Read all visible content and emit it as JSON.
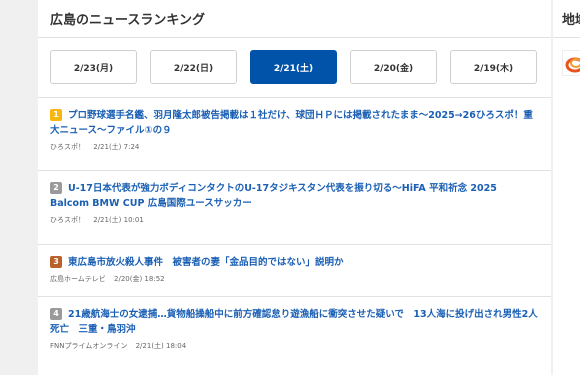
{
  "main": {
    "title": "広島のニュースランキング",
    "date_tabs": [
      {
        "label": "2/23(月)",
        "active": false
      },
      {
        "label": "2/22(日)",
        "active": false
      },
      {
        "label": "2/21(土)",
        "active": true
      },
      {
        "label": "2/20(金)",
        "active": false
      },
      {
        "label": "2/19(木)",
        "active": false
      }
    ],
    "news": [
      {
        "rank": "1",
        "badge_color": "#f6b70e",
        "headline": "プロ野球選手名鑑、羽月隆太郎被告掲載は１社だけ、球団ＨＰには掲載されたまま～2025→26ひろスポ！重大ニュース～ファイル①の９",
        "source": "ひろスポ！",
        "time": "2/21(土) 7:24"
      },
      {
        "rank": "2",
        "badge_color": "#9a9a9a",
        "headline": "U-17日本代表が強力ボディコンタクトのU-17タジキスタン代表を振り切る～HiFA 平和祈念 2025 Balcom BMW CUP 広島国際ユースサッカー",
        "source": "ひろスポ！",
        "time": "2/21(土) 10:01"
      },
      {
        "rank": "3",
        "badge_color": "#b9602b",
        "headline": "東広島市放火殺人事件　被害者の妻「金品目的ではない」説明か",
        "source": "広島ホームテレビ",
        "time": "2/20(金) 18:52"
      },
      {
        "rank": "4",
        "badge_color": "#9a9a9a",
        "headline": "21歳航海士の女逮捕…貨物船操船中に前方確認怠り遊漁船に衝突させた疑いで　13人海に投げ出され男性2人死亡　三重・鳥羽沖",
        "source": "FNNプライムオンライン",
        "time": "2/21(土) 18:04"
      }
    ]
  },
  "side": {
    "title": "地域"
  }
}
